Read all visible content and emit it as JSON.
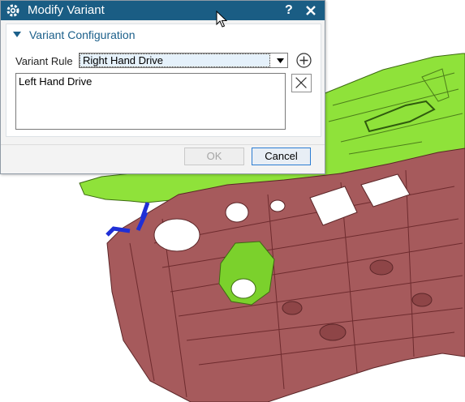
{
  "dialog": {
    "title": "Modify Variant",
    "help_label": "?",
    "section_title": "Variant Configuration",
    "variant_rule": {
      "label": "Variant Rule",
      "selected": "Right Hand Drive"
    },
    "list_items": [
      "Left Hand Drive"
    ],
    "ok_label": "OK",
    "cancel_label": "Cancel"
  },
  "icons": {
    "title": "gear-icon",
    "close": "close-icon",
    "collapse": "triangle-down-icon",
    "dropdown": "chevron-down-icon",
    "add": "plus-circle-icon",
    "remove": "x-icon",
    "cursor": "mouse-pointer-icon"
  },
  "colors": {
    "titlebar": "#1a5d84",
    "section_title": "#1b5f8a",
    "model_green": "#8fe23a",
    "model_red": "#a65a5c"
  }
}
